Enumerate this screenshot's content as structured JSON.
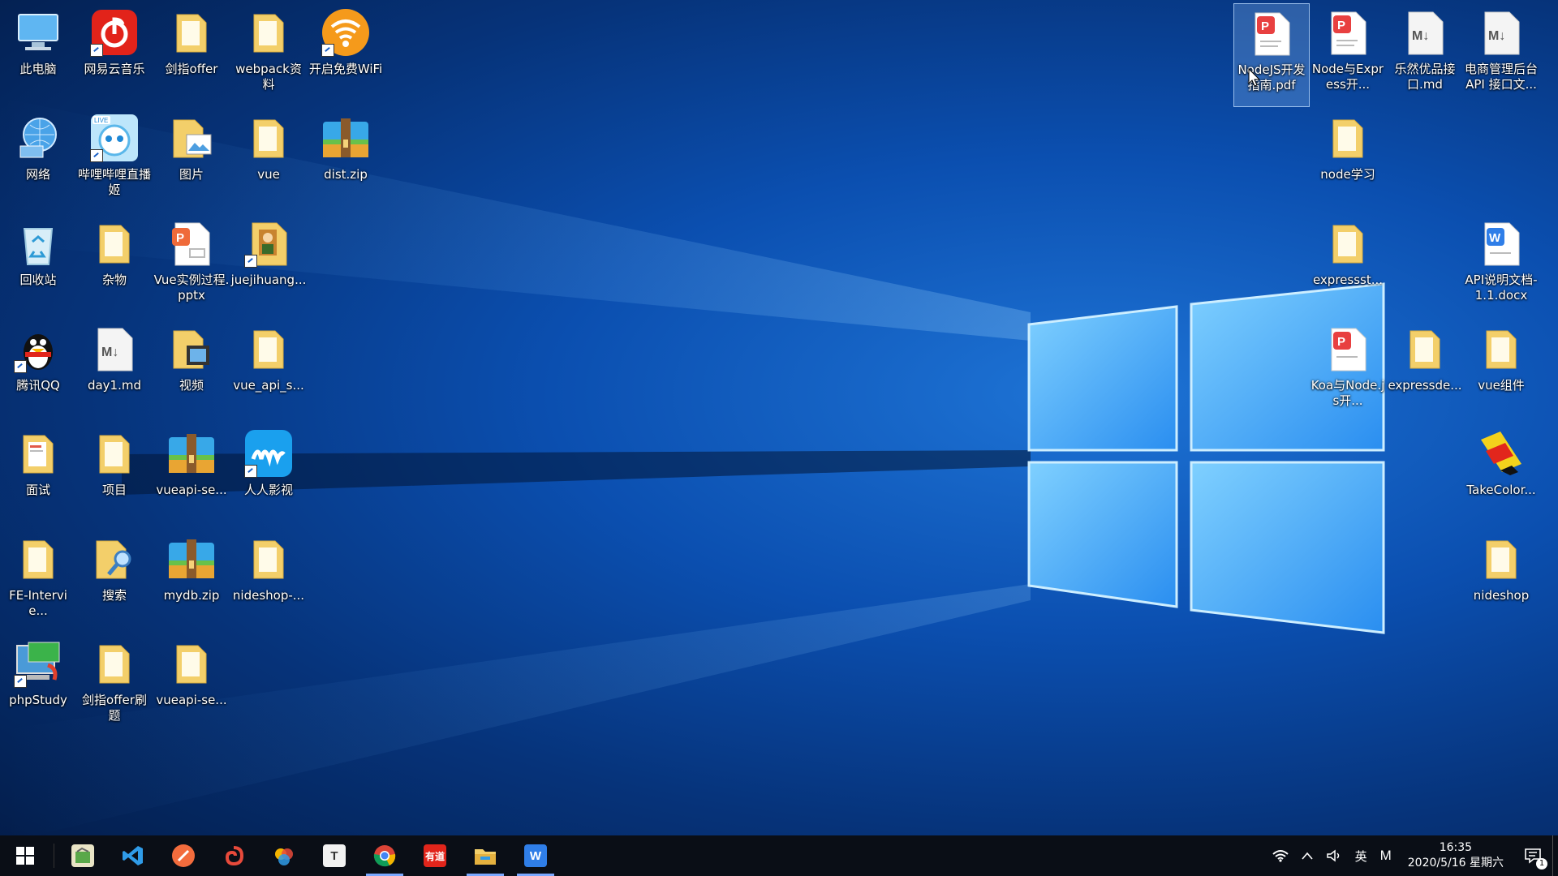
{
  "desktop": {
    "icons": [
      {
        "label": "此电脑"
      },
      {
        "label": "网易云音乐"
      },
      {
        "label": "剑指offer"
      },
      {
        "label": "webpack资料"
      },
      {
        "label": "开启免费WiFi"
      },
      {
        "label": "网络"
      },
      {
        "label": "哔哩哔哩直播姬"
      },
      {
        "label": "图片"
      },
      {
        "label": "vue"
      },
      {
        "label": "dist.zip"
      },
      {
        "label": "回收站"
      },
      {
        "label": "杂物"
      },
      {
        "label": "Vue实例过程.pptx"
      },
      {
        "label": "juejihuang..."
      },
      {
        "label": "腾讯QQ"
      },
      {
        "label": "day1.md"
      },
      {
        "label": "视频"
      },
      {
        "label": "vue_api_s..."
      },
      {
        "label": "面试"
      },
      {
        "label": "项目"
      },
      {
        "label": "vueapi-se..."
      },
      {
        "label": "人人影视"
      },
      {
        "label": "FE-Intervie..."
      },
      {
        "label": "搜索"
      },
      {
        "label": "mydb.zip"
      },
      {
        "label": "nideshop-..."
      },
      {
        "label": "phpStudy"
      },
      {
        "label": "剑指offer刷题"
      },
      {
        "label": "vueapi-se..."
      },
      {
        "label": "NodeJS开发指南.pdf"
      },
      {
        "label": "Node与Express开..."
      },
      {
        "label": "乐然优品接口.md"
      },
      {
        "label": "电商管理后台API 接口文..."
      },
      {
        "label": "node学习"
      },
      {
        "label": "expressst..."
      },
      {
        "label": "API说明文档-1.1.docx"
      },
      {
        "label": "Koa与Node.js开..."
      },
      {
        "label": "expressde..."
      },
      {
        "label": "vue组件"
      },
      {
        "label": "TakeColor..."
      },
      {
        "label": "nideshop"
      }
    ]
  },
  "taskbar": {
    "apps": [
      "start",
      "tool",
      "vscode",
      "postman",
      "browser-swirl",
      "paint",
      "typora",
      "chrome",
      "youdao",
      "explorer",
      "wps"
    ],
    "tray": {
      "ime": "英",
      "ime_mode": "M"
    },
    "clock": {
      "time": "16:35",
      "date": "2020/5/16 星期六"
    },
    "notifications": "1"
  },
  "colors": {
    "taskbar": "#0a0e16",
    "accent": "#7aa8ff",
    "folder": "#f3cf6a"
  }
}
